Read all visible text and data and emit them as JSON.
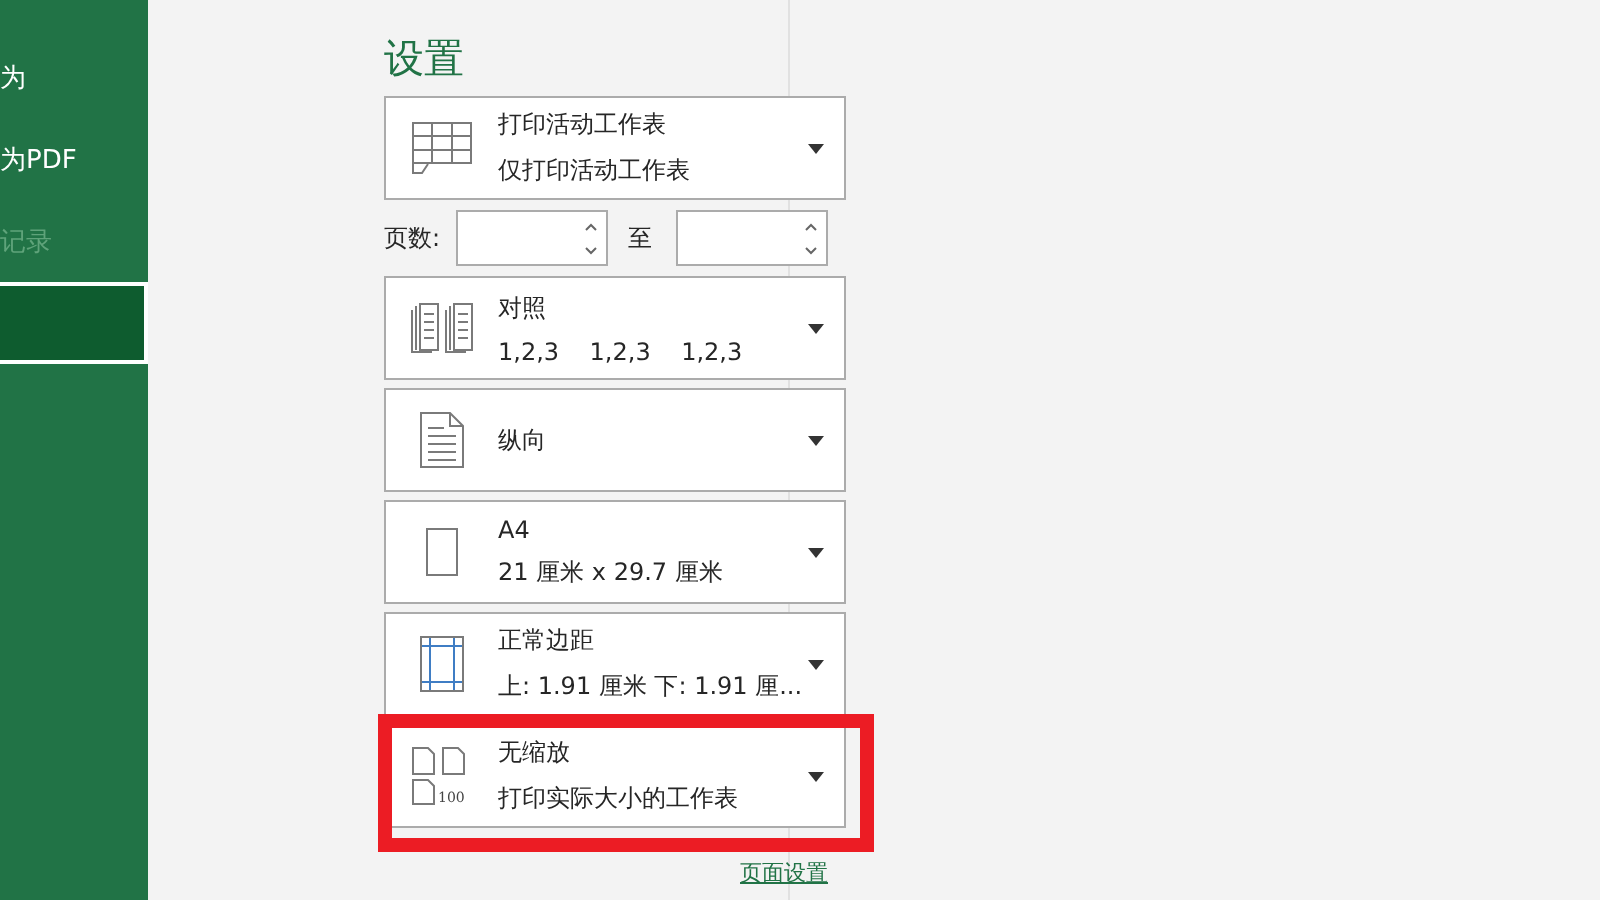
{
  "sidebar": {
    "items": [
      {
        "label": "为",
        "disabled": false,
        "selected": false
      },
      {
        "label": "为PDF",
        "disabled": false,
        "selected": false
      },
      {
        "label": "记录",
        "disabled": true,
        "selected": false
      },
      {
        "disabled": false,
        "selected": true
      }
    ]
  },
  "settings": {
    "title": "设置",
    "options": [
      {
        "kind": "sheets",
        "title": "打印活动工作表",
        "subtitle": "仅打印活动工作表",
        "highlighted": false
      },
      {
        "kind": "pages",
        "label": "页数:",
        "to": "至"
      },
      {
        "kind": "collate",
        "title": "对照",
        "subtitle": "1,2,3    1,2,3    1,2,3",
        "highlighted": false
      },
      {
        "kind": "portrait",
        "title": "纵向",
        "highlighted": false
      },
      {
        "kind": "paper",
        "title": "A4",
        "subtitle": "21 厘米 x 29.7 厘米",
        "highlighted": false
      },
      {
        "kind": "margins",
        "title": "正常边距",
        "subtitle": "上: 1.91 厘米 下: 1.91 厘...",
        "highlighted": false
      },
      {
        "kind": "scale",
        "title": "无缩放",
        "subtitle": "打印实际大小的工作表",
        "icon_text": "100",
        "highlighted": true
      }
    ],
    "link": "页面设置"
  }
}
